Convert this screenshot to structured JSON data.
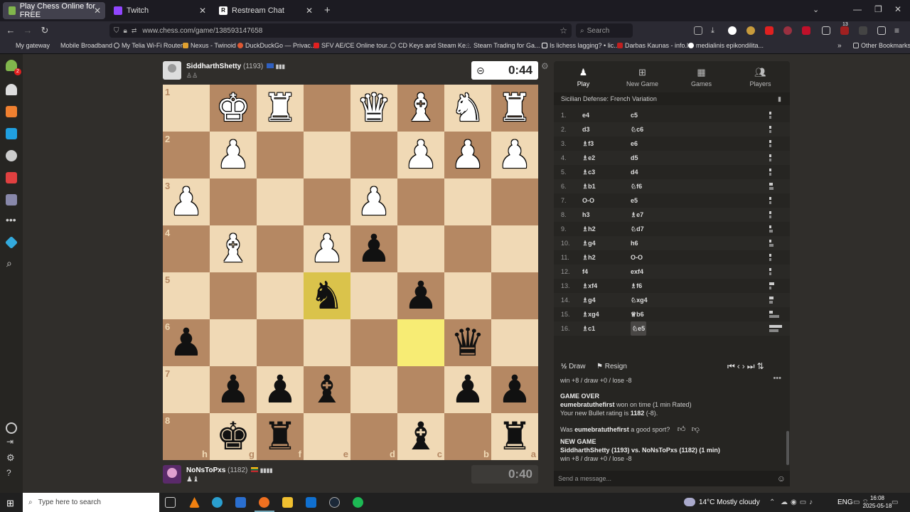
{
  "browser": {
    "tabs": [
      {
        "title": "Play Chess Online for FREE",
        "active": true,
        "color": "#81b64c"
      },
      {
        "title": "Twitch",
        "active": false,
        "color": "#9146ff"
      },
      {
        "title": "Restream Chat",
        "active": false,
        "color": "#ffffff"
      }
    ],
    "url": "www.chess.com/game/138593147658",
    "search_placeholder": "Search",
    "bookmarks": [
      "My gateway",
      "Mobile Broadband",
      "My Telia Wi-Fi Router",
      "Nexus - Twinoid",
      "DuckDuckGo — Privac...",
      "SFV AE/CE Online tour...",
      "CD Keys and Steam Ke...",
      "Steam Trading for Ga...",
      "Is lichess lagging? • lic...",
      "Darbas Kaunas - info.lt",
      "medialinis epikondilita..."
    ],
    "other_bookmarks": "Other Bookmarks",
    "notification_count": "13"
  },
  "sidebar": {
    "badge": "2"
  },
  "top_player": {
    "name": "SiddharthShetty",
    "rating": "(1193)",
    "clock": "0:44"
  },
  "bottom_player": {
    "name": "NoNsToPxs",
    "rating": "(1182)",
    "clock": "0:40"
  },
  "board": {
    "ranks": [
      "1",
      "2",
      "3",
      "4",
      "5",
      "6",
      "7",
      "8"
    ],
    "files": [
      "h",
      "g",
      "f",
      "e",
      "d",
      "c",
      "b",
      "a"
    ],
    "rows": [
      [
        "",
        "wk",
        "wr",
        "",
        "wq",
        "wb",
        "wn",
        "wr"
      ],
      [
        "",
        "wp",
        "",
        "",
        "",
        "wp",
        "wp",
        "wp"
      ],
      [
        "wp",
        "",
        "",
        "",
        "wp",
        "",
        "",
        ""
      ],
      [
        "",
        "wb",
        "",
        "wp",
        "bp",
        "",
        "",
        ""
      ],
      [
        "",
        "",
        "",
        "bn",
        "",
        "bp",
        "",
        ""
      ],
      [
        "bp",
        "",
        "",
        "",
        "",
        "",
        "bq",
        ""
      ],
      [
        "",
        "bp",
        "bp",
        "bb",
        "",
        "",
        "bp",
        "bp"
      ],
      [
        "",
        "bk",
        "br",
        "",
        "",
        "bb",
        "",
        "br"
      ]
    ],
    "highlight_from": [
      5,
      5
    ],
    "highlight_to": [
      4,
      3
    ]
  },
  "panel": {
    "tabs": [
      "Play",
      "New Game",
      "Games",
      "Players"
    ],
    "opening": "Sicilian Defense: French Variation",
    "moves": [
      {
        "n": "1.",
        "w": "e4",
        "b": "c5",
        "wt": "0.1s",
        "bt": "0.9s"
      },
      {
        "n": "2.",
        "w": "d3",
        "b": "♘c6",
        "wt": "0.1s",
        "bt": "0.5s"
      },
      {
        "n": "3.",
        "w": "♗f3",
        "b": "e6",
        "wt": "0.1s",
        "bt": "0.6s"
      },
      {
        "n": "4.",
        "w": "♗e2",
        "b": "d5",
        "wt": "0.1s",
        "bt": "0.1s"
      },
      {
        "n": "5.",
        "w": "♗c3",
        "b": "d4",
        "wt": "0.8s",
        "bt": "0.7s"
      },
      {
        "n": "6.",
        "w": "♗b1",
        "b": "♘f6",
        "wt": "1.5s",
        "bt": "1.8s"
      },
      {
        "n": "7.",
        "w": "O-O",
        "b": "e5",
        "wt": "0.1s",
        "bt": "0.8s"
      },
      {
        "n": "8.",
        "w": "h3",
        "b": "♗e7",
        "wt": "0.5s",
        "bt": "0.4s"
      },
      {
        "n": "9.",
        "w": "♗h2",
        "b": "♘d7",
        "wt": "0.1s",
        "bt": "1.3s"
      },
      {
        "n": "10.",
        "w": "♗g4",
        "b": "h6",
        "wt": "0.1s",
        "bt": "1.7s"
      },
      {
        "n": "11.",
        "w": "♗h2",
        "b": "O-O",
        "wt": "0.1s",
        "bt": "0.7s"
      },
      {
        "n": "12.",
        "w": "f4",
        "b": "exf4",
        "wt": "0.8s",
        "bt": "0.7s"
      },
      {
        "n": "13.",
        "w": "♗xf4",
        "b": "♗f6",
        "wt": "2.1s",
        "bt": "0.9s"
      },
      {
        "n": "14.",
        "w": "♗g4",
        "b": "♘xg4",
        "wt": "1.7s",
        "bt": "1.3s"
      },
      {
        "n": "15.",
        "w": "♗xg4",
        "b": "♕b6",
        "wt": "1.3s",
        "bt": "4.0s"
      },
      {
        "n": "16.",
        "w": "♗c1",
        "b": "♘e5",
        "wt": "5.5s",
        "bt": "3.7s"
      }
    ],
    "draw": "Draw",
    "resign": "Resign",
    "chat": {
      "l1": "win +8 / draw +0 / lose -8",
      "game_over": "GAME OVER",
      "winner": "eumebratuthefirst",
      "won_text": " won on time (1 min Rated)",
      "rating_text": "Your new Bullet rating is ",
      "rating_value": "1182",
      "rating_delta": " (-8).",
      "sport_pre": "Was ",
      "sport_name": "eumebratuthefirst",
      "sport_post": " a good sport?",
      "new_game": "NEW GAME",
      "matchup": "SiddharthShetty (1193) vs. NoNsToPxs (1182) (1 min)",
      "l2": "win +8 / draw +0 / lose -8",
      "placeholder": "Send a message..."
    }
  },
  "taskbar": {
    "search": "Type here to search",
    "weather": "14°C  Mostly cloudy",
    "lang": "ENG",
    "time": "16:08",
    "date": "2025-05-18"
  }
}
